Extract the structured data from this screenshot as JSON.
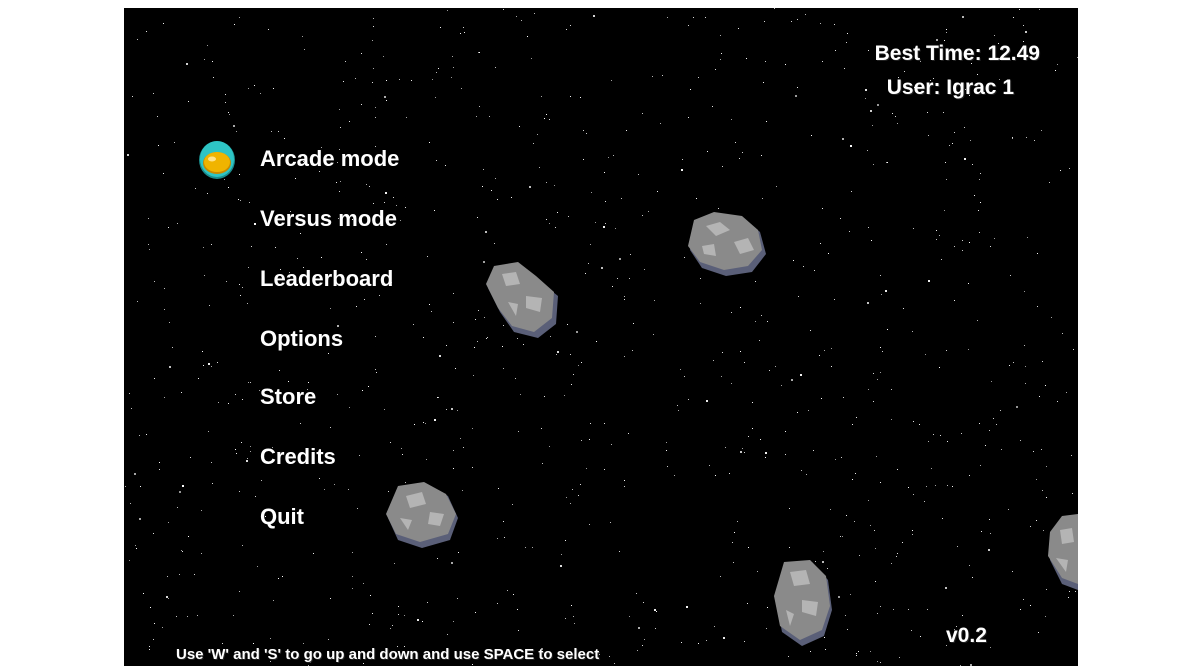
{
  "hud": {
    "best_time": "Best Time: 12.49",
    "user": "User: Igrac 1",
    "version": "v0.2"
  },
  "menu": {
    "items": [
      {
        "label": "Arcade mode",
        "selected": true
      },
      {
        "label": "Versus mode",
        "selected": false
      },
      {
        "label": "Leaderboard",
        "selected": false
      },
      {
        "label": "Options",
        "selected": false
      },
      {
        "label": "Store",
        "selected": false
      },
      {
        "label": "Credits",
        "selected": false
      },
      {
        "label": "Quit",
        "selected": false
      }
    ],
    "cursor_icon": "helmet-icon"
  },
  "hint": "Use 'W' and 'S' to go up and down and use SPACE to select",
  "colors": {
    "background": "#000000",
    "text": "#ffffff",
    "helmet_shell": "#2ec4c4",
    "helmet_visor": "#f0b400",
    "asteroid": "#8a8a8a",
    "asteroid_shadow": "#5a5f78"
  }
}
